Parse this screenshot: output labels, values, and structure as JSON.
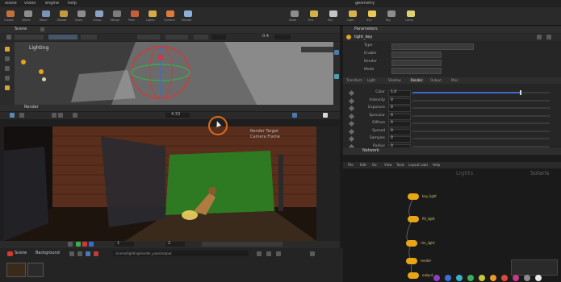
{
  "menubar": {
    "items": [
      "scene",
      "vision",
      "engine",
      "help"
    ],
    "right_items": [
      "geometry"
    ]
  },
  "shelf_left": {
    "tools": [
      {
        "label": "Create",
        "color": "#c46f3e"
      },
      {
        "label": "Select",
        "color": "#8d8d8d"
      },
      {
        "label": "Move",
        "color": "#7d93b5"
      },
      {
        "label": "Rotate",
        "color": "#c49a3e"
      },
      {
        "label": "Scale",
        "color": "#8d8d8d"
      },
      {
        "label": "Group",
        "color": "#8aa2c4"
      },
      {
        "label": "Merge",
        "color": "#7d7d7d"
      },
      {
        "label": "Pack",
        "color": "#c45f3e"
      },
      {
        "label": "Lights",
        "color": "#d8a84a"
      },
      {
        "label": "Camera",
        "color": "#e07a3a"
      },
      {
        "label": "Render",
        "color": "#8ab0d8"
      }
    ]
  },
  "shelf_right": {
    "tools": [
      {
        "label": "Node",
        "color": "#8d8d8d"
      },
      {
        "label": "Env",
        "color": "#d5b04a"
      },
      {
        "label": "Sky",
        "color": "#c4c4c4"
      },
      {
        "label": "Light",
        "color": "#d8b24a"
      },
      {
        "label": "Sun",
        "color": "#e8c850"
      },
      {
        "label": "Rig",
        "color": "#8d8d8d"
      },
      {
        "label": "Lamp",
        "color": "#e0d070"
      }
    ]
  },
  "viewport_top": {
    "tab": "Scene",
    "header_label": "Lighting",
    "frame_value": "0.4",
    "gizmo": "rotate-gizmo"
  },
  "render_view": {
    "tab": "Render",
    "status_value": "4.33",
    "overlay_labels": [
      "Render Target",
      "Camera Frame"
    ]
  },
  "timeline": {
    "frame": "1",
    "end": "2"
  },
  "bottom_bar": {
    "tab_a": "Scene",
    "tab_b": "Background",
    "path_text": "/scene/lighting/render_pass/output"
  },
  "params": {
    "tab": "Parameters",
    "node_name": "light_key",
    "header_fields": [
      "Type",
      "Enable",
      "Render",
      "Mode"
    ],
    "tabs": [
      "Transform",
      "Light",
      "Shadow",
      "Render",
      "Output",
      "Misc"
    ],
    "rows": [
      {
        "label": "Color",
        "value": "1.0"
      },
      {
        "label": "Intensity",
        "value": "0"
      },
      {
        "label": "Exposure",
        "value": "0"
      },
      {
        "label": "Specular",
        "value": "0"
      },
      {
        "label": "Diffuse",
        "value": "0"
      },
      {
        "label": "Spread",
        "value": "0"
      },
      {
        "label": "Samples",
        "value": "0"
      },
      {
        "label": "Radius",
        "value": "0"
      }
    ],
    "slider_level": 0.78
  },
  "network": {
    "tab": "Network",
    "menu": [
      "File",
      "Edit",
      "Go",
      "View",
      "Tools",
      "Layout",
      "Labs",
      "Help"
    ],
    "title": "Lights",
    "title_right": "Solaris",
    "nodes": [
      {
        "label": "key_light"
      },
      {
        "label": "fill_light"
      },
      {
        "label": "rim_light"
      },
      {
        "label": "render"
      },
      {
        "label": "output"
      }
    ],
    "color_swatches": [
      "#8e3ec4",
      "#3b6fd8",
      "#3ab0c8",
      "#3bb05a",
      "#c8c83a",
      "#e89a2a",
      "#d84a3a",
      "#c43a8a",
      "#8a8a8a",
      "#e8e8e8"
    ]
  }
}
